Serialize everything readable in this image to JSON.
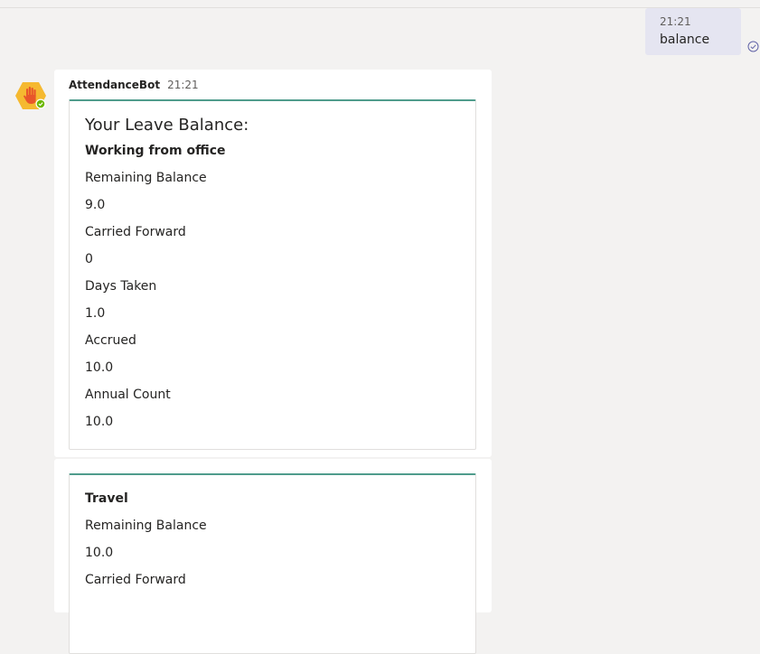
{
  "user_message": {
    "time": "21:21",
    "text": "balance",
    "status_icon": "read-check-icon"
  },
  "bot": {
    "name": "AttendanceBot",
    "time": "21:21",
    "avatar_icon": "hand-hexagon-icon",
    "presence": "available",
    "colors": {
      "accent": "#4f9c8c",
      "avatar": "#f5b930",
      "presence": "#6bb700"
    }
  },
  "balance_card": {
    "title": "Your Leave Balance:",
    "category": "Working from office",
    "fields": [
      {
        "label": "Remaining Balance",
        "value": "9.0"
      },
      {
        "label": "Carried Forward",
        "value": "0"
      },
      {
        "label": "Days Taken",
        "value": "1.0"
      },
      {
        "label": "Accrued",
        "value": "10.0"
      },
      {
        "label": "Annual Count",
        "value": "10.0"
      }
    ]
  },
  "travel_card": {
    "category": "Travel",
    "fields": [
      {
        "label": "Remaining Balance",
        "value": "10.0"
      },
      {
        "label": "Carried Forward",
        "value": ""
      }
    ]
  }
}
